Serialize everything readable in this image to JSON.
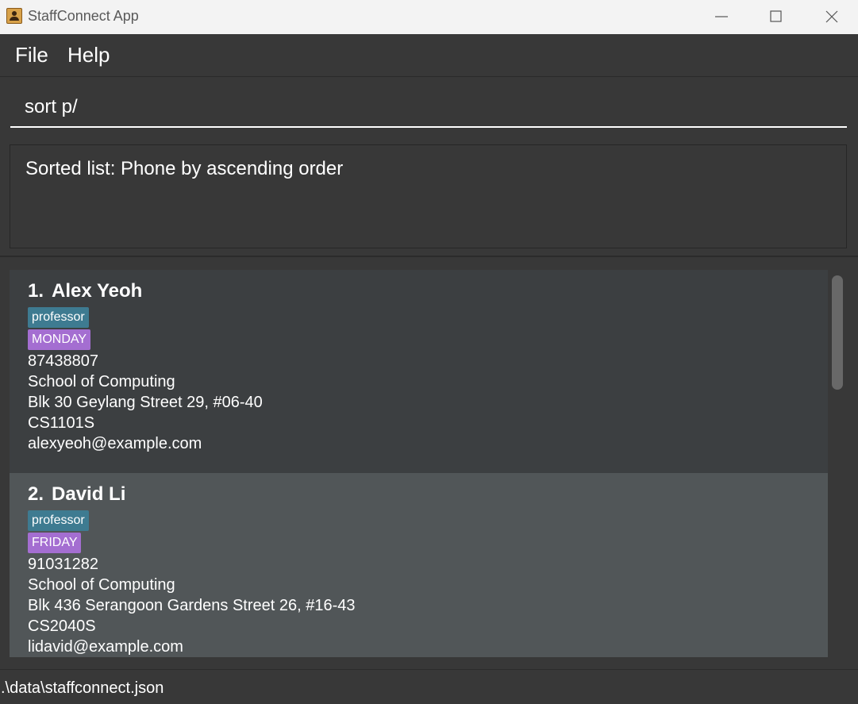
{
  "window": {
    "title": "StaffConnect App"
  },
  "menu": {
    "file": "File",
    "help": "Help"
  },
  "command": {
    "value": "sort p/"
  },
  "result": {
    "text": "Sorted list: Phone by ascending order"
  },
  "persons": [
    {
      "index": "1.",
      "name": "Alex Yeoh",
      "role": "professor",
      "availability": "MONDAY",
      "phone": "87438807",
      "faculty": "School of Computing",
      "address": "Blk 30 Geylang Street 29, #06-40",
      "module": "CS1101S",
      "email": "alexyeoh@example.com"
    },
    {
      "index": "2.",
      "name": "David Li",
      "role": "professor",
      "availability": "FRIDAY",
      "phone": "91031282",
      "faculty": "School of Computing",
      "address": "Blk 436 Serangoon Gardens Street 26, #16-43",
      "module": "CS2040S",
      "email": "lidavid@example.com"
    }
  ],
  "status": {
    "file_path": ".\\data\\staffconnect.json"
  },
  "colors": {
    "role_tag": "#3e7b91",
    "availability_tag": "#a46ed1",
    "background": "#383838",
    "selected_card": "#515658"
  }
}
